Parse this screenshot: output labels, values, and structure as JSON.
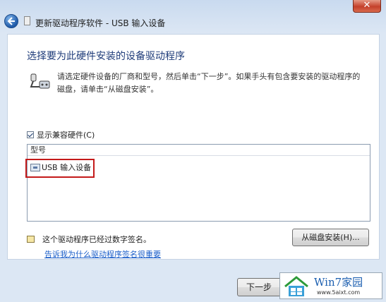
{
  "window": {
    "title": "更新驱动程序软件 - USB 输入设备",
    "close_label": "✕"
  },
  "content": {
    "heading": "选择要为此硬件安装的设备驱动程序",
    "instructions": "请选定硬件设备的厂商和型号，然后单击“下一步”。如果手头有包含要安装的驱动程序的磁盘，请单击“从磁盘安装”。",
    "show_compatible_label": "显示兼容硬件(C)",
    "show_compatible_checked": true,
    "list": {
      "header": "型号",
      "items": [
        "USB 输入设备"
      ]
    },
    "signature_text": "这个驱动程序已经过数字签名。",
    "signature_link": "告诉我为什么驱动程序签名很重要",
    "disk_button_label": "从磁盘安装(H)..."
  },
  "footer": {
    "next_button_label": "下一步"
  },
  "watermark": {
    "title": "Win7家园",
    "url": "www.5aixt.com"
  },
  "colors": {
    "heading": "#1f3c7a",
    "link": "#1a5ec9",
    "highlight_box": "#c41a1a"
  }
}
